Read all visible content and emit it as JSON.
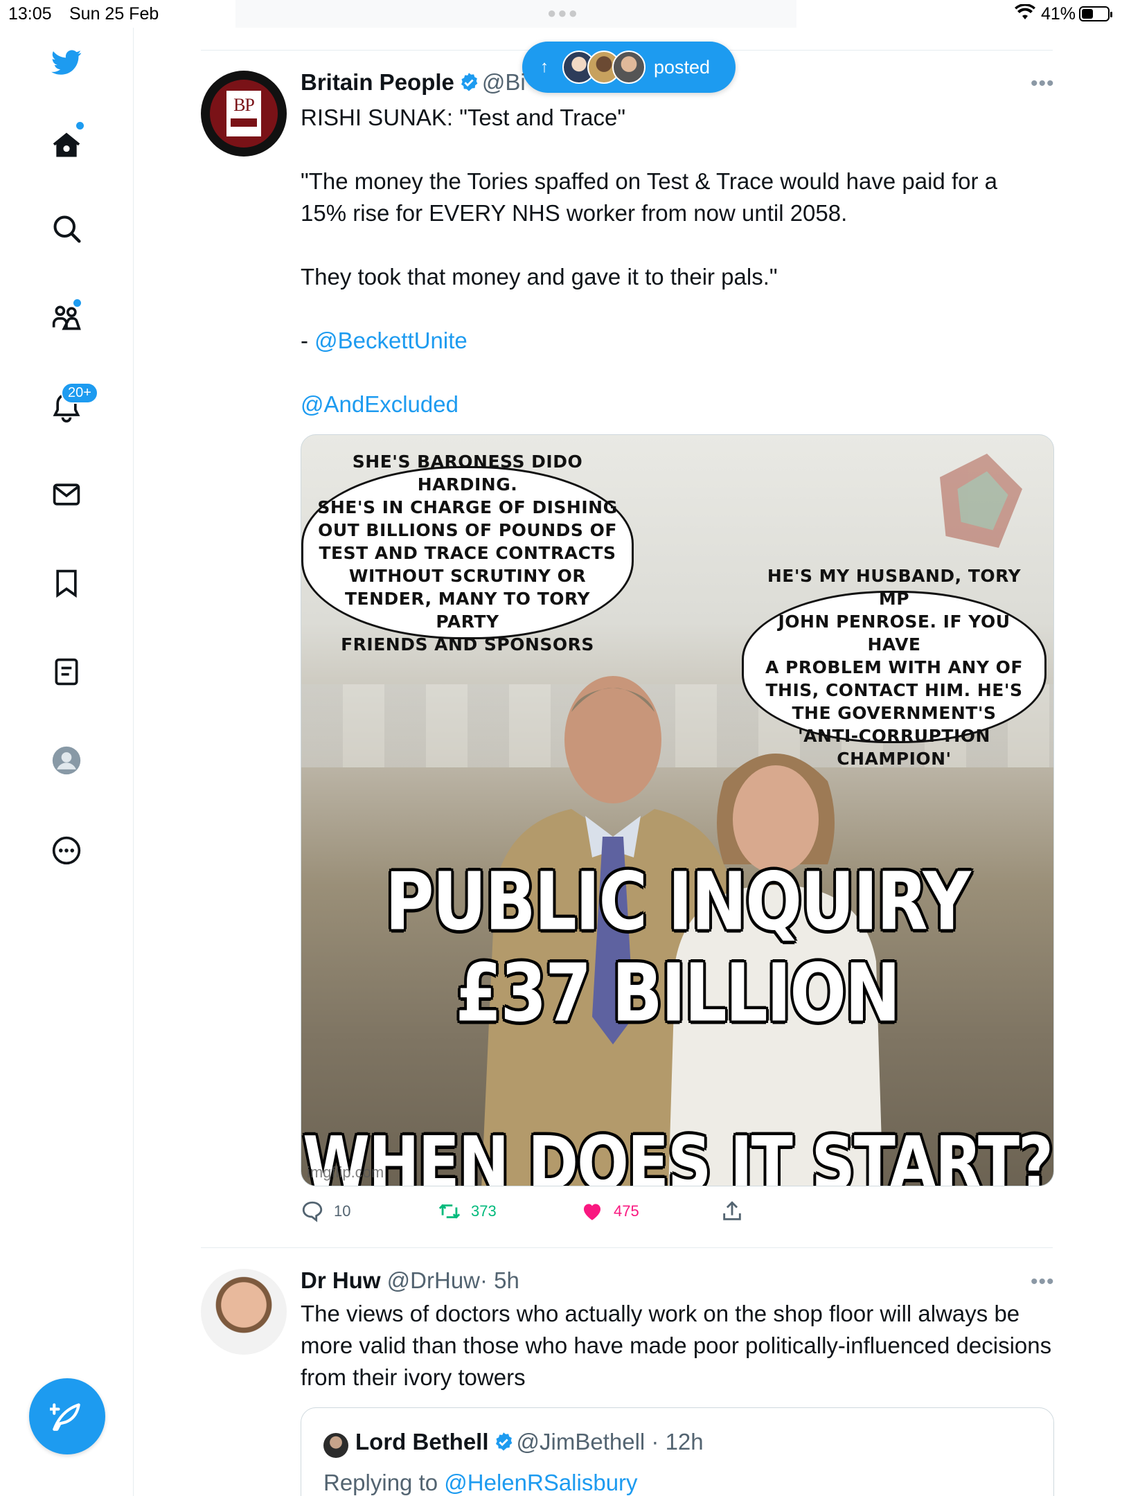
{
  "status_bar": {
    "time": "13:05",
    "date": "Sun 25 Feb",
    "battery": "41%",
    "battery_level": 0.41
  },
  "sidebar": {
    "notification_badge": "20+"
  },
  "new_posts_pill": {
    "label": "posted"
  },
  "tweet1": {
    "name": "Britain People",
    "handle": "@Bi",
    "text_line1": "RISHI SUNAK:  \"Test and Trace\"",
    "text_line2": "\"The money the Tories spaffed on Test & Trace would have paid for a 15% rise for EVERY NHS worker from now until 2058.",
    "text_line3": "They took that money and gave it to their pals.\"",
    "dash": "- ",
    "mention1": "@BeckettUnite",
    "mention2": "@AndExcluded",
    "meme": {
      "bubble_left": "SHE'S BARONESS DIDO HARDING.\nSHE'S IN CHARGE OF DISHING\nOUT BILLIONS OF POUNDS OF\nTEST AND TRACE CONTRACTS\nWITHOUT SCRUTINY OR\nTENDER, MANY TO TORY PARTY\nFRIENDS  AND SPONSORS",
      "bubble_right": "HE'S MY HUSBAND, TORY MP\nJOHN PENROSE. IF YOU HAVE\nA PROBLEM WITH ANY OF\nTHIS, CONTACT HIM. HE'S\nTHE GOVERNMENT'S\n'ANTI-CORRUPTION CHAMPION'",
      "caption_line1": "PUBLIC INQUIRY",
      "caption_line2": "£37 BILLION",
      "caption_line3": "WHEN DOES IT START?",
      "source": "imgflip.com"
    },
    "replies": "10",
    "retweets": "373",
    "likes": "475",
    "colors": {
      "retweet": "#00ba7c",
      "like": "#f91880",
      "link": "#1d9bf0"
    }
  },
  "tweet2": {
    "name": "Dr Huw",
    "handle": "@DrHuw",
    "time": "· 5h",
    "text": "The views of doctors who actually work on the shop floor will always be more valid than those who have made poor politically-influenced decisions from their ivory towers",
    "quoted": {
      "name": "Lord Bethell",
      "handle": "@JimBethell",
      "time": "· 12h",
      "replying_prefix": "Replying to ",
      "replying_to": "@HelenRSalisbury"
    }
  },
  "icons": [
    "twitter-logo-icon",
    "home-icon",
    "search-icon",
    "communities-icon",
    "notifications-icon",
    "messages-icon",
    "bookmarks-icon",
    "lists-icon",
    "profile-icon",
    "more-icon",
    "compose-icon",
    "reply-icon",
    "retweet-icon",
    "like-icon",
    "share-icon",
    "verified-icon"
  ]
}
